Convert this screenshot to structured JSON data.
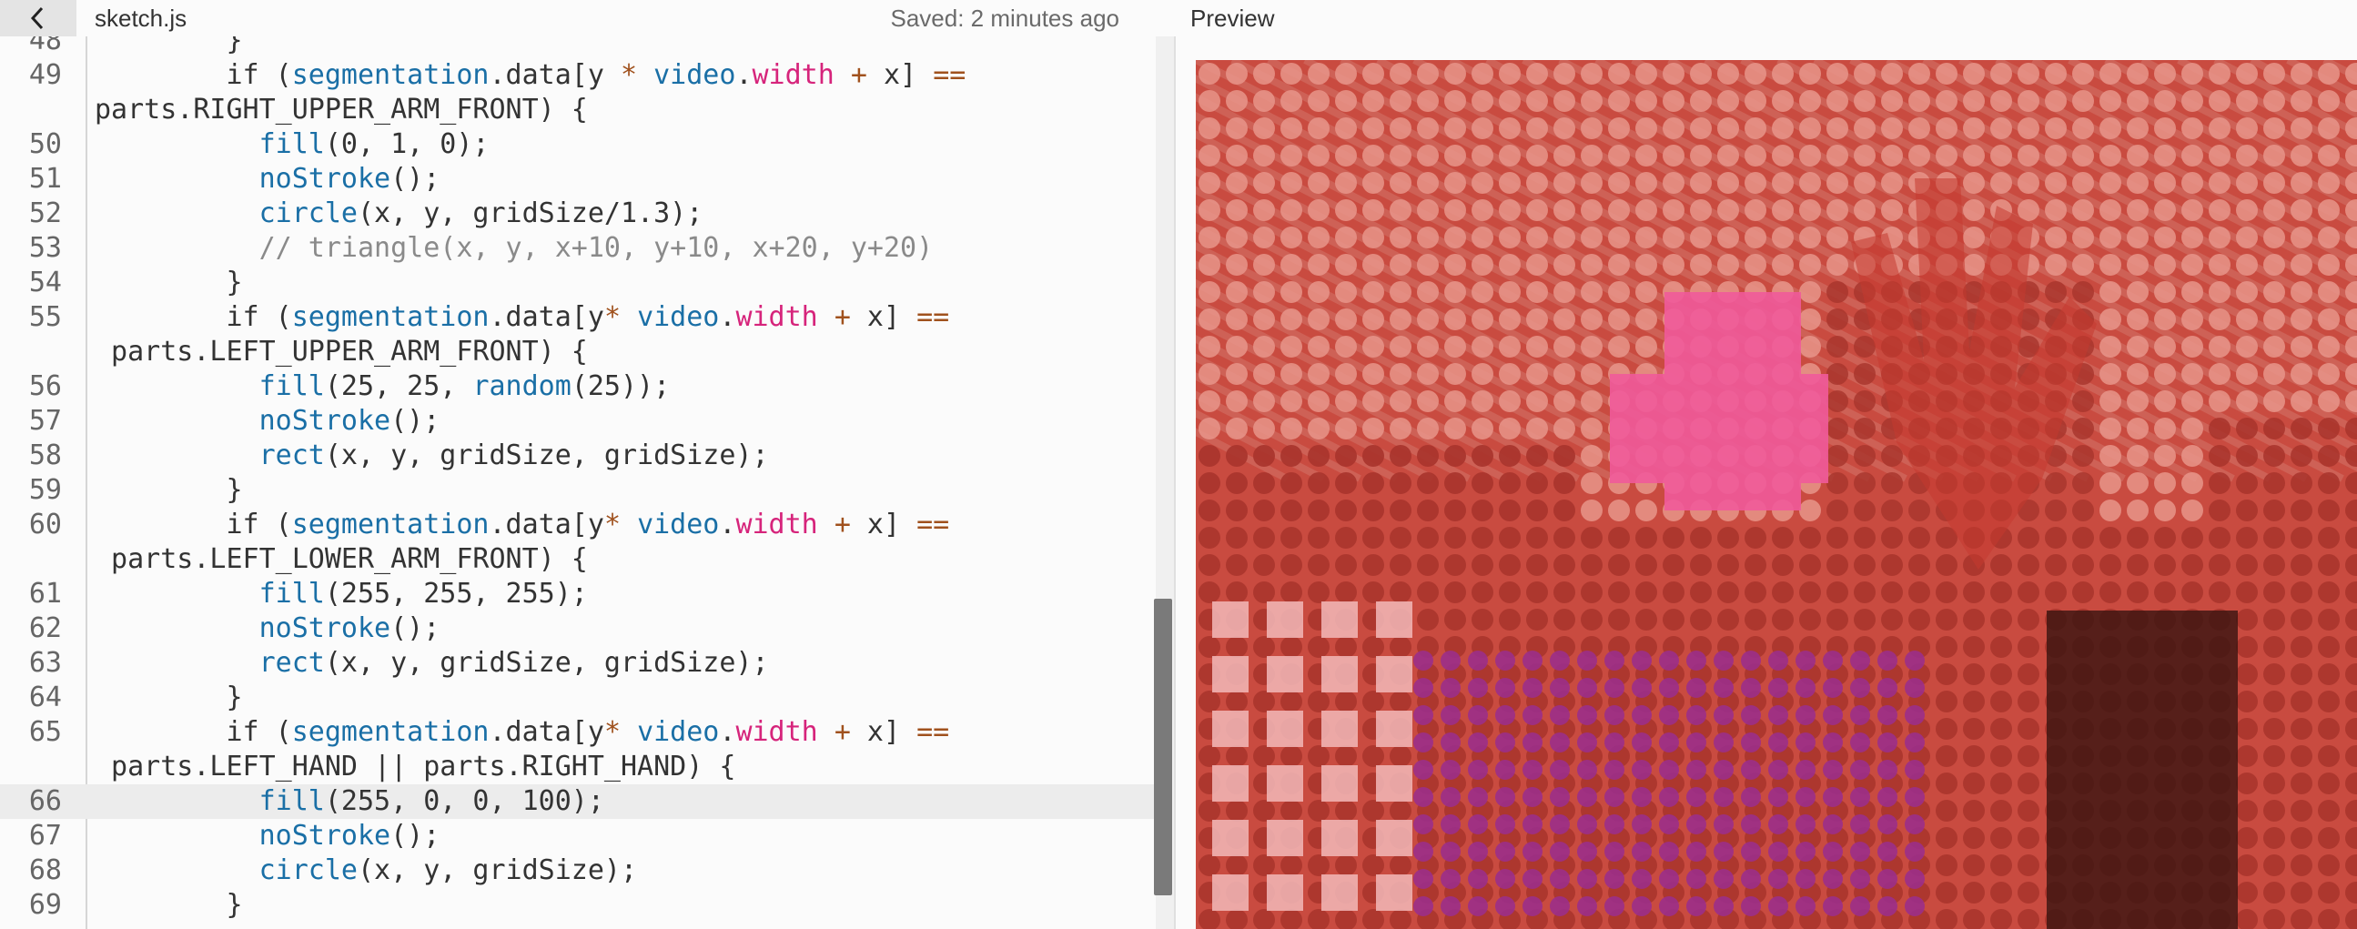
{
  "header": {
    "back_icon": "chevron-left-icon",
    "file_name": "sketch.js",
    "saved_status": "Saved: 2 minutes ago",
    "preview_title": "Preview"
  },
  "editor": {
    "active_line": 66,
    "lines": [
      {
        "n": "48",
        "html": "        }"
      },
      {
        "n": "49",
        "html": "        if (<span class=\"fn\">segmentation</span>.data[y <span class=\"op\">*</span> <span class=\"prop\">video</span>.<span class=\"kw-mag\">width</span> <span class=\"op\">+</span> x] <span class=\"op\">==</span>"
      },
      {
        "n": "",
        "html": "parts.RIGHT_UPPER_ARM_FRONT) {"
      },
      {
        "n": "50",
        "html": "          <span class=\"fn\">fill</span>(0, 1, 0);"
      },
      {
        "n": "51",
        "html": "          <span class=\"fn\">noStroke</span>();"
      },
      {
        "n": "52",
        "html": "          <span class=\"fn\">circle</span>(x, y, gridSize/1.3);"
      },
      {
        "n": "53",
        "html": "          <span class=\"cm\">// triangle(x, y, x+10, y+10, x+20, y+20)</span>"
      },
      {
        "n": "54",
        "html": "        }"
      },
      {
        "n": "55",
        "html": "        if (<span class=\"fn\">segmentation</span>.data[y<span class=\"op\">*</span> <span class=\"prop\">video</span>.<span class=\"kw-mag\">width</span> <span class=\"op\">+</span> x] <span class=\"op\">==</span>"
      },
      {
        "n": "",
        "html": " parts.LEFT_UPPER_ARM_FRONT) {"
      },
      {
        "n": "56",
        "html": "          <span class=\"fn\">fill</span>(25, 25, <span class=\"fn\">random</span>(25));"
      },
      {
        "n": "57",
        "html": "          <span class=\"fn\">noStroke</span>();"
      },
      {
        "n": "58",
        "html": "          <span class=\"fn\">rect</span>(x, y, gridSize, gridSize);"
      },
      {
        "n": "59",
        "html": "        }"
      },
      {
        "n": "60",
        "html": "        if (<span class=\"fn\">segmentation</span>.data[y<span class=\"op\">*</span> <span class=\"prop\">video</span>.<span class=\"kw-mag\">width</span> <span class=\"op\">+</span> x] <span class=\"op\">==</span>"
      },
      {
        "n": "",
        "html": " parts.LEFT_LOWER_ARM_FRONT) {"
      },
      {
        "n": "61",
        "html": "          <span class=\"fn\">fill</span>(255, 255, 255);"
      },
      {
        "n": "62",
        "html": "          <span class=\"fn\">noStroke</span>();"
      },
      {
        "n": "63",
        "html": "          <span class=\"fn\">rect</span>(x, y, gridSize, gridSize);"
      },
      {
        "n": "64",
        "html": "        }"
      },
      {
        "n": "65",
        "html": "        if (<span class=\"fn\">segmentation</span>.data[y<span class=\"op\">*</span> <span class=\"prop\">video</span>.<span class=\"kw-mag\">width</span> <span class=\"op\">+</span> x] <span class=\"op\">==</span>"
      },
      {
        "n": "",
        "html": " parts.LEFT_HAND || parts.RIGHT_HAND) {"
      },
      {
        "n": "66",
        "html": "          <span class=\"fn\">fill</span>(255, 0, 0, 100);",
        "active": true
      },
      {
        "n": "67",
        "html": "          <span class=\"fn\">noStroke</span>();"
      },
      {
        "n": "68",
        "html": "          <span class=\"fn\">circle</span>(x, y, gridSize);"
      },
      {
        "n": "69",
        "html": "        }"
      }
    ]
  },
  "preview": {
    "description_icon": "webcam-preview-canvas",
    "colors": {
      "background": "#c94b40",
      "dot_light": "#e8958a",
      "dot_dark": "#a8342c",
      "face_pink": "#f05a9a",
      "face_red": "#e83a3a",
      "body_purple": "#9b2f8a",
      "body_gray": "#b59a8a",
      "hand_dark": "#3a1410"
    }
  }
}
